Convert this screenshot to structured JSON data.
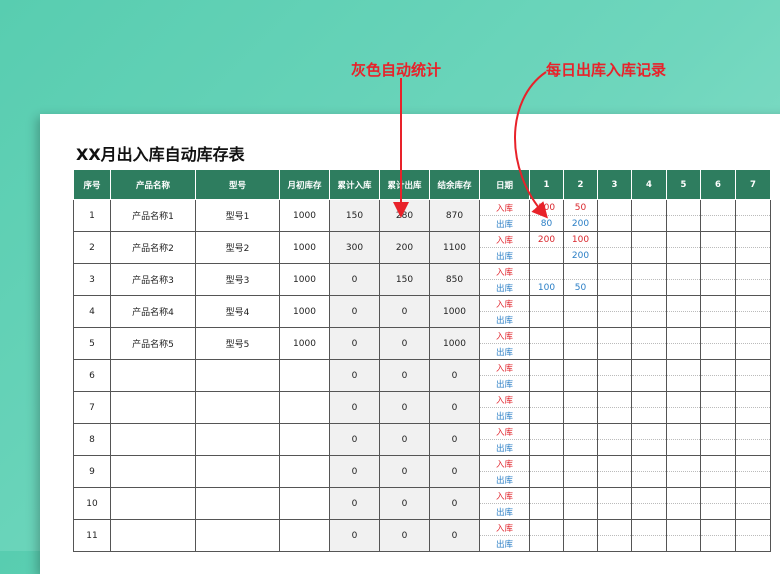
{
  "callouts": {
    "gray_auto": "灰色自动统计",
    "daily_record": "每日出库入库记录"
  },
  "sheet": {
    "title": "XX月出入库自动库存表",
    "headers": {
      "no": "序号",
      "name": "产品名称",
      "model": "型号",
      "opening": "月初库存",
      "total_in": "累计入库",
      "total_out": "累计出库",
      "balance": "结余库存",
      "date": "日期",
      "days": [
        "1",
        "2",
        "3",
        "4",
        "5",
        "6",
        "7"
      ]
    },
    "in_label": "入库",
    "out_label": "出库",
    "rows": [
      {
        "no": "1",
        "name": "产品名称1",
        "model": "型号1",
        "opening": "1000",
        "total_in": "150",
        "total_out": "280",
        "balance": "870",
        "in": [
          "100",
          "50",
          "",
          "",
          "",
          "",
          ""
        ],
        "out": [
          "80",
          "200",
          "",
          "",
          "",
          "",
          ""
        ]
      },
      {
        "no": "2",
        "name": "产品名称2",
        "model": "型号2",
        "opening": "1000",
        "total_in": "300",
        "total_out": "200",
        "balance": "1100",
        "in": [
          "200",
          "100",
          "",
          "",
          "",
          "",
          ""
        ],
        "out": [
          "",
          "200",
          "",
          "",
          "",
          "",
          ""
        ]
      },
      {
        "no": "3",
        "name": "产品名称3",
        "model": "型号3",
        "opening": "1000",
        "total_in": "0",
        "total_out": "150",
        "balance": "850",
        "in": [
          "",
          "",
          "",
          "",
          "",
          "",
          ""
        ],
        "out": [
          "100",
          "50",
          "",
          "",
          "",
          "",
          ""
        ]
      },
      {
        "no": "4",
        "name": "产品名称4",
        "model": "型号4",
        "opening": "1000",
        "total_in": "0",
        "total_out": "0",
        "balance": "1000",
        "in": [
          "",
          "",
          "",
          "",
          "",
          "",
          ""
        ],
        "out": [
          "",
          "",
          "",
          "",
          "",
          "",
          ""
        ]
      },
      {
        "no": "5",
        "name": "产品名称5",
        "model": "型号5",
        "opening": "1000",
        "total_in": "0",
        "total_out": "0",
        "balance": "1000",
        "in": [
          "",
          "",
          "",
          "",
          "",
          "",
          ""
        ],
        "out": [
          "",
          "",
          "",
          "",
          "",
          "",
          ""
        ]
      },
      {
        "no": "6",
        "name": "",
        "model": "",
        "opening": "",
        "total_in": "0",
        "total_out": "0",
        "balance": "0",
        "in": [
          "",
          "",
          "",
          "",
          "",
          "",
          ""
        ],
        "out": [
          "",
          "",
          "",
          "",
          "",
          "",
          ""
        ]
      },
      {
        "no": "7",
        "name": "",
        "model": "",
        "opening": "",
        "total_in": "0",
        "total_out": "0",
        "balance": "0",
        "in": [
          "",
          "",
          "",
          "",
          "",
          "",
          ""
        ],
        "out": [
          "",
          "",
          "",
          "",
          "",
          "",
          ""
        ]
      },
      {
        "no": "8",
        "name": "",
        "model": "",
        "opening": "",
        "total_in": "0",
        "total_out": "0",
        "balance": "0",
        "in": [
          "",
          "",
          "",
          "",
          "",
          "",
          ""
        ],
        "out": [
          "",
          "",
          "",
          "",
          "",
          "",
          ""
        ]
      },
      {
        "no": "9",
        "name": "",
        "model": "",
        "opening": "",
        "total_in": "0",
        "total_out": "0",
        "balance": "0",
        "in": [
          "",
          "",
          "",
          "",
          "",
          "",
          ""
        ],
        "out": [
          "",
          "",
          "",
          "",
          "",
          "",
          ""
        ]
      },
      {
        "no": "10",
        "name": "",
        "model": "",
        "opening": "",
        "total_in": "0",
        "total_out": "0",
        "balance": "0",
        "in": [
          "",
          "",
          "",
          "",
          "",
          "",
          ""
        ],
        "out": [
          "",
          "",
          "",
          "",
          "",
          "",
          ""
        ]
      },
      {
        "no": "11",
        "name": "",
        "model": "",
        "opening": "",
        "total_in": "0",
        "total_out": "0",
        "balance": "0",
        "in": [
          "",
          "",
          "",
          "",
          "",
          "",
          ""
        ],
        "out": [
          "",
          "",
          "",
          "",
          "",
          "",
          ""
        ]
      }
    ]
  },
  "colors": {
    "header_bg": "#2e7d5f",
    "in_color": "#e0222a",
    "out_color": "#2a7ec5",
    "callout_color": "#e8222a"
  }
}
